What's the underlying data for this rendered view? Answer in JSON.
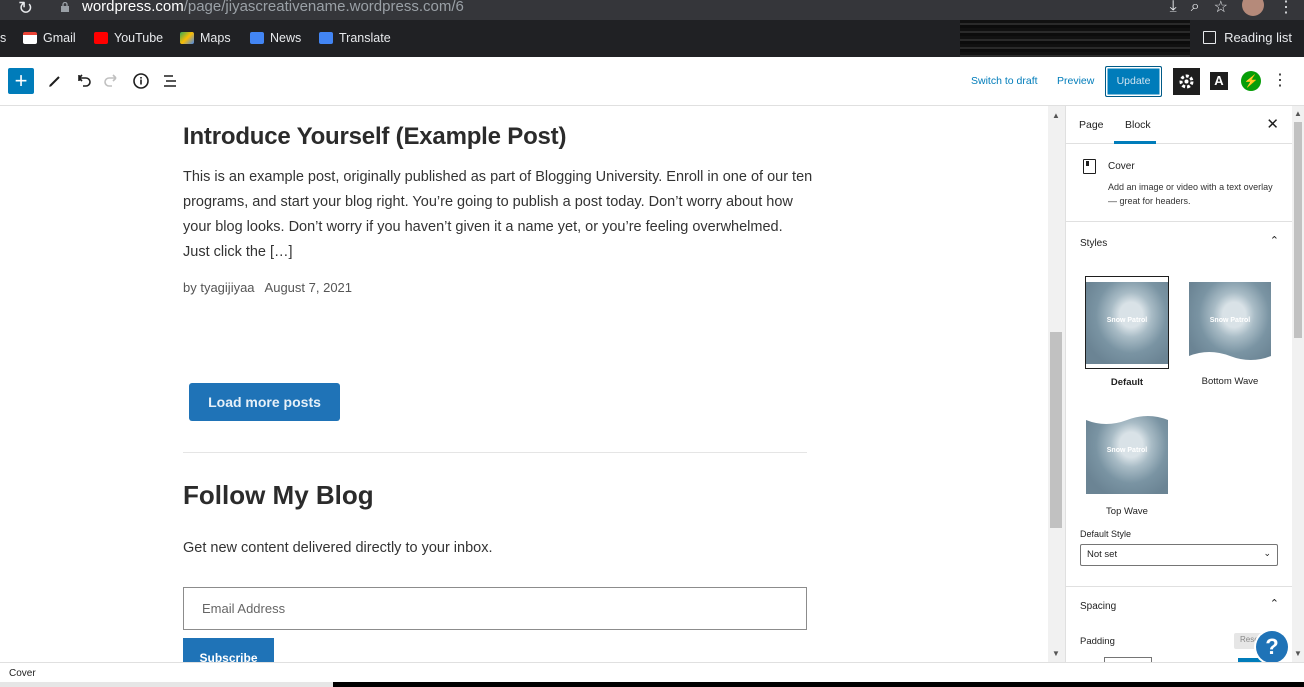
{
  "browser": {
    "url_host": "wordpress.com",
    "url_path": "/page/jiyascreativename.wordpress.com/6",
    "bookmarks": [
      {
        "label": "s",
        "color": ""
      },
      {
        "label": "Gmail",
        "color": "#ea4335"
      },
      {
        "label": "YouTube",
        "color": "#ff0000"
      },
      {
        "label": "Maps",
        "color": "#34a853"
      },
      {
        "label": "News",
        "color": "#4285f4"
      },
      {
        "label": "Translate",
        "color": "#4285f4"
      }
    ],
    "reading_list": "Reading list"
  },
  "toolbar": {
    "switch_to_draft": "Switch to draft",
    "preview": "Preview",
    "update": "Update",
    "typography_letter": "A"
  },
  "post": {
    "title": "Introduce Yourself (Example Post)",
    "excerpt": "This is an example post, originally published as part of Blogging University. Enroll in one of our ten programs, and start your blog right. You’re going to publish a post today. Don’t worry about how your blog looks. Don’t worry if you haven’t given it a name yet, or you’re feeling overwhelmed. Just click the […]",
    "author": "by tyagijiyaa",
    "date": "August 7, 2021"
  },
  "load_more": "Load more posts",
  "follow": {
    "title": "Follow My Blog",
    "text": "Get new content delivered directly to your inbox.",
    "email_placeholder": "Email Address",
    "subscribe": "Subscribe"
  },
  "sidebar": {
    "tabs": [
      "Page",
      "Block"
    ],
    "active_tab": "Block",
    "block_name": "Cover",
    "block_description": "Add an image or video with a text overlay — great for headers.",
    "styles_title": "Styles",
    "preview_caption": "Snow Patrol",
    "styles": [
      {
        "label": "Default",
        "selected": true
      },
      {
        "label": "Bottom Wave",
        "selected": false
      },
      {
        "label": "Top Wave",
        "selected": false
      }
    ],
    "default_style_label": "Default Style",
    "default_style_value": "Not set",
    "spacing_title": "Spacing",
    "padding_label": "Padding",
    "reset_label": "Reset"
  },
  "footer": {
    "breadcrumb": "Cover"
  },
  "colors": {
    "accent": "#007cba",
    "button": "#1f73b7"
  }
}
